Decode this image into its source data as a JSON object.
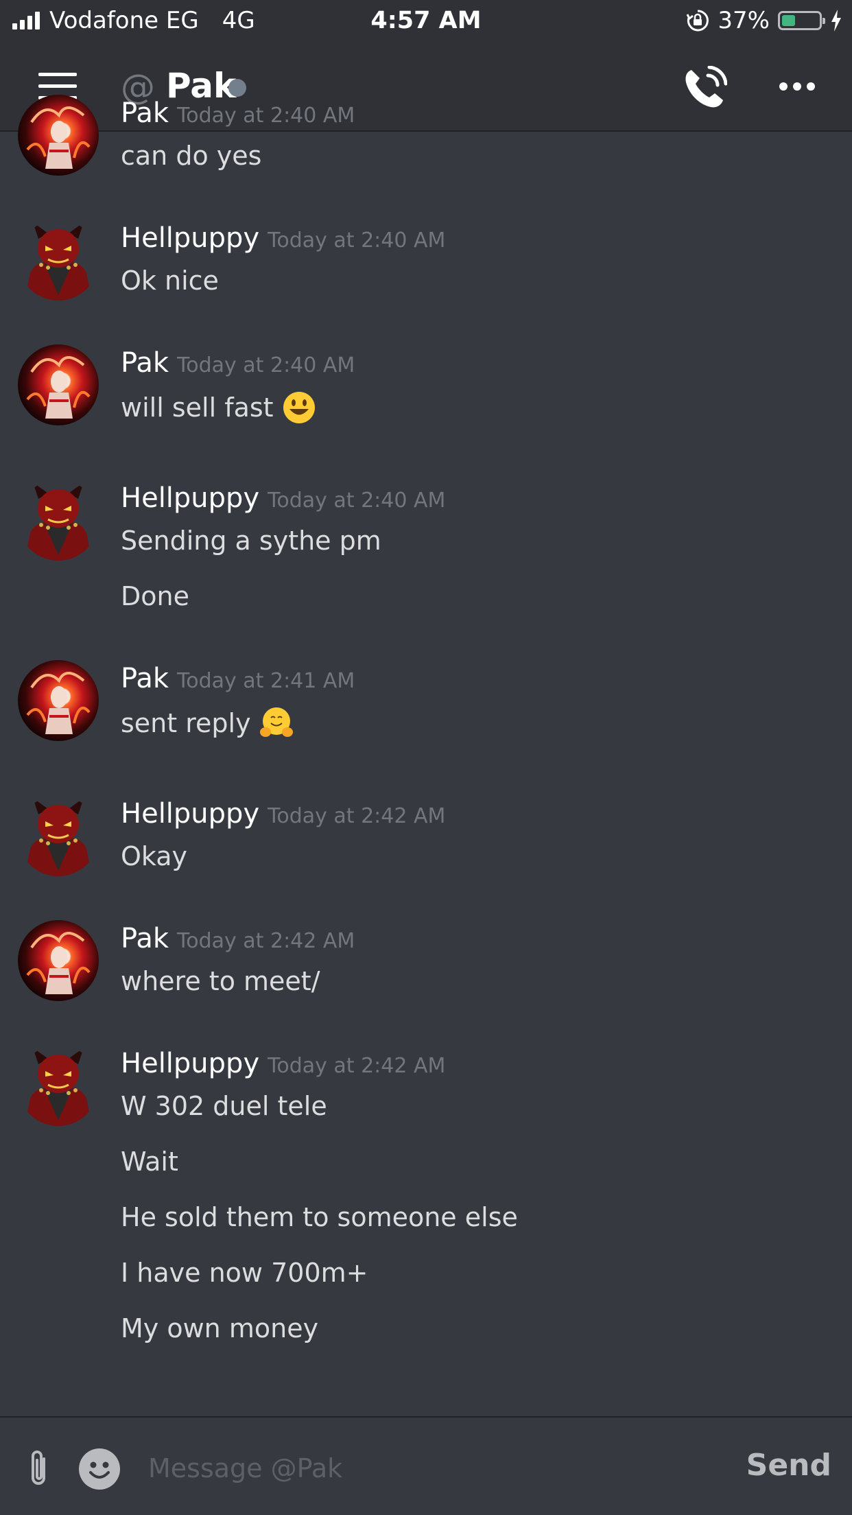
{
  "status_bar": {
    "carrier": "Vodafone EG",
    "network": "4G",
    "time": "4:57 AM",
    "battery": "37%",
    "battery_level": 0.37
  },
  "header": {
    "title": "Pak",
    "at_symbol": "@",
    "status_color": "#747f8d"
  },
  "messages": [
    {
      "author": "Pak",
      "timestamp": "Today at 2:40 AM",
      "lines": [
        "can do yes"
      ]
    },
    {
      "author": "Hellpuppy",
      "timestamp": "Today at 2:40 AM",
      "lines": [
        "Ok nice"
      ]
    },
    {
      "author": "Pak",
      "timestamp": "Today at 2:40 AM",
      "lines": [
        "will sell fast"
      ],
      "emoji": "smiley-emoji"
    },
    {
      "author": "Hellpuppy",
      "timestamp": "Today at 2:40 AM",
      "lines": [
        "Sending a sythe pm",
        "Done"
      ]
    },
    {
      "author": "Pak",
      "timestamp": "Today at 2:41 AM",
      "lines": [
        "sent reply"
      ],
      "emoji": "hugging-emoji"
    },
    {
      "author": "Hellpuppy",
      "timestamp": "Today at 2:42 AM",
      "lines": [
        "Okay"
      ]
    },
    {
      "author": "Pak",
      "timestamp": "Today at 2:42 AM",
      "lines": [
        "where to meet/"
      ]
    },
    {
      "author": "Hellpuppy",
      "timestamp": "Today at 2:42 AM",
      "lines": [
        "W 302 duel tele",
        "Wait",
        "He sold them to someone else",
        "I have now 700m+",
        "My own money"
      ]
    }
  ],
  "composer": {
    "placeholder": "Message @Pak",
    "send_label": "Send"
  },
  "colors": {
    "background": "#36393f",
    "header_bg": "#2f3136",
    "timestamp": "#72767d",
    "online_green": "#43b581"
  }
}
